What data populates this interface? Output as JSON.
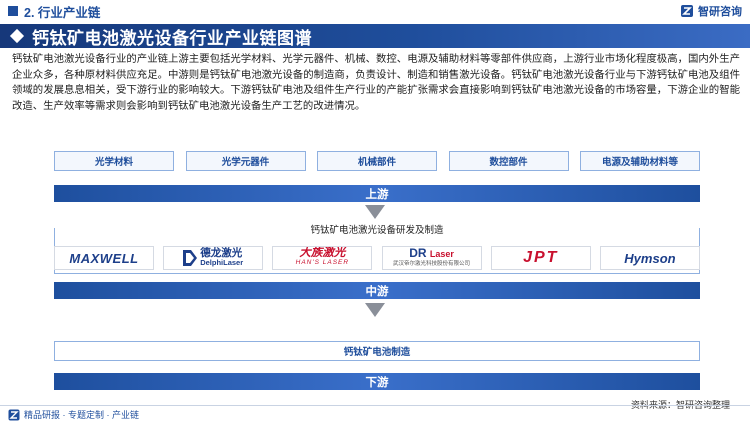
{
  "header": {
    "section": "2. 行业产业链",
    "brand": "智研咨询"
  },
  "title": "钙钛矿电池激光设备行业产业链图谱",
  "description": "钙钛矿电池激光设备行业的产业链上游主要包括光学材料、光学元器件、机械、数控、电源及辅助材料等零部件供应商，上游行业市场化程度极高，国内外生产企业众多，各种原材料供应充足。中游则是钙钛矿电池激光设备的制造商，负责设计、制造和销售激光设备。钙钛矿电池激光设备行业与下游钙钛矿电池及组件领域的发展息息相关，受下游行业的影响较大。下游钙钛矿电池及组件生产行业的产能扩张需求会直接影响到钙钛矿电池激光设备的市场容量，下游企业的智能改造、生产效率等需求则会影响到钙钛矿电池激光设备生产工艺的改进情况。",
  "upstream": {
    "items": [
      "光学材料",
      "光学元器件",
      "机械部件",
      "数控部件",
      "电源及辅助材料等"
    ],
    "label": "上游"
  },
  "midstream": {
    "title": "钙钛矿电池激光设备研发及制造",
    "label": "中游",
    "brands": {
      "maxwell": "MAXWELL",
      "delphi_cn": "德龙激光",
      "delphi_en": "DelphiLaser",
      "hans_cn": "大族激光",
      "hans_en": "HAN'S LASER",
      "dr": "DR",
      "dr_laser": "Laser",
      "dr_sub": "武汉帝尔激光科技股份有限公司",
      "jpt": "JPT",
      "hymson": "Hymson"
    }
  },
  "downstream": {
    "item": "钙钛矿电池制造",
    "label": "下游"
  },
  "footer": {
    "source": "资料来源：智研咨询整理",
    "tagline": "精品研报 · 专题定制 · 产业链"
  },
  "colors": {
    "primary": "#1f4e9c",
    "accent_red": "#c8102e",
    "box_border": "#8fb0e0"
  }
}
